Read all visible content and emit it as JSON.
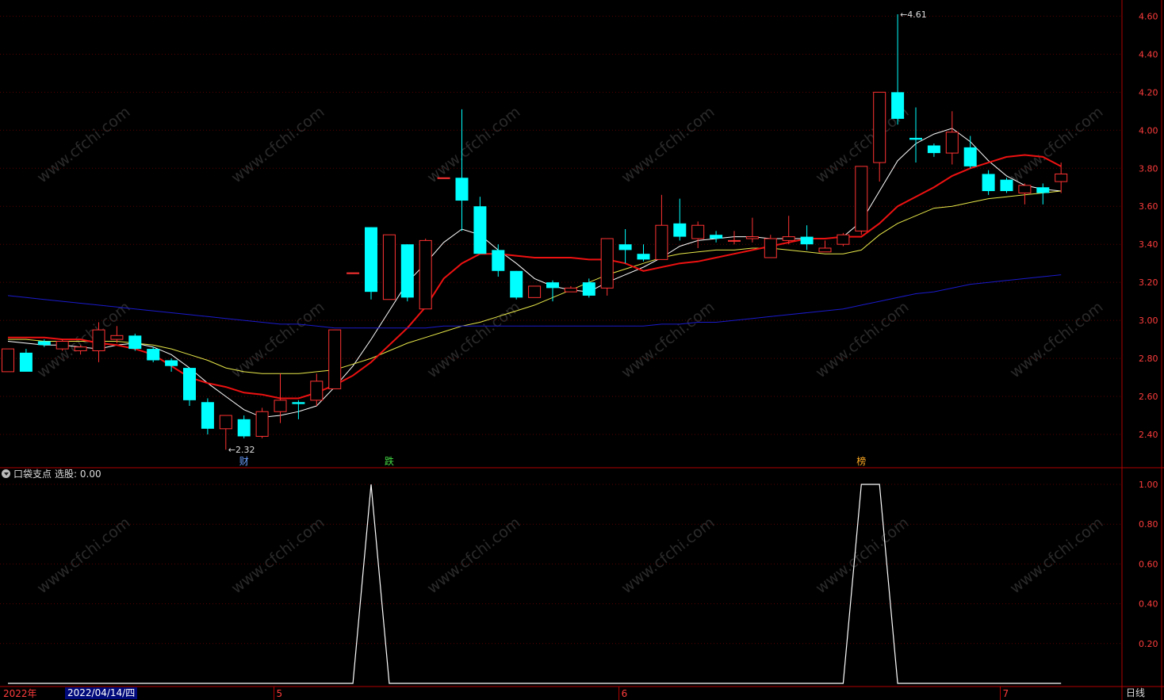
{
  "chart_data": [
    {
      "type": "candlestick",
      "ylim": [
        2.25,
        4.66
      ],
      "yticks": [
        "2.40",
        "2.60",
        "2.80",
        "3.00",
        "3.20",
        "3.40",
        "3.60",
        "3.80",
        "4.00",
        "4.20",
        "4.40",
        "4.60"
      ],
      "candles": [
        [
          2.73,
          2.85,
          2.75,
          2.84
        ],
        [
          2.83,
          2.73,
          2.74,
          2.85
        ],
        [
          2.89,
          2.87,
          2.86,
          2.9
        ],
        [
          2.85,
          2.89,
          2.84,
          2.9
        ],
        [
          2.84,
          2.86,
          2.82,
          2.87
        ],
        [
          2.84,
          2.95,
          2.78,
          2.99
        ],
        [
          2.9,
          2.92,
          2.88,
          2.97
        ],
        [
          2.92,
          2.85,
          2.84,
          2.93
        ],
        [
          2.85,
          2.79,
          2.78,
          2.86
        ],
        [
          2.79,
          2.76,
          2.73,
          2.8
        ],
        [
          2.75,
          2.58,
          2.55,
          2.75
        ],
        [
          2.57,
          2.43,
          2.4,
          2.59
        ],
        [
          2.43,
          2.5,
          2.32,
          2.5
        ],
        [
          2.48,
          2.39,
          2.38,
          2.5
        ],
        [
          2.39,
          2.52,
          2.38,
          2.54
        ],
        [
          2.52,
          2.58,
          2.46,
          2.72
        ],
        [
          2.57,
          2.56,
          2.48,
          2.58
        ],
        [
          2.58,
          2.68,
          2.55,
          2.72
        ],
        [
          2.64,
          2.95,
          2.64,
          2.95
        ],
        [
          3.25,
          3.25,
          3.25,
          3.25
        ],
        [
          3.49,
          3.15,
          3.11,
          3.49
        ],
        [
          3.11,
          3.45,
          3.11,
          3.45
        ],
        [
          3.4,
          3.12,
          3.1,
          3.4
        ],
        [
          3.06,
          3.42,
          3.06,
          3.43
        ],
        [
          3.75,
          3.75,
          3.75,
          3.75
        ],
        [
          3.75,
          3.63,
          3.47,
          4.11
        ],
        [
          3.6,
          3.35,
          3.35,
          3.65
        ],
        [
          3.37,
          3.26,
          3.23,
          3.4
        ],
        [
          3.26,
          3.12,
          3.11,
          3.26
        ],
        [
          3.12,
          3.18,
          3.12,
          3.18
        ],
        [
          3.2,
          3.17,
          3.1,
          3.21
        ],
        [
          3.15,
          3.17,
          3.15,
          3.18
        ],
        [
          3.2,
          3.13,
          3.12,
          3.22
        ],
        [
          3.17,
          3.43,
          3.13,
          3.43
        ],
        [
          3.4,
          3.37,
          3.3,
          3.48
        ],
        [
          3.35,
          3.32,
          3.31,
          3.4
        ],
        [
          3.32,
          3.5,
          3.32,
          3.66
        ],
        [
          3.51,
          3.44,
          3.42,
          3.64
        ],
        [
          3.43,
          3.5,
          3.38,
          3.52
        ],
        [
          3.45,
          3.43,
          3.41,
          3.47
        ],
        [
          3.42,
          3.42,
          3.4,
          3.47
        ],
        [
          3.43,
          3.44,
          3.41,
          3.54
        ],
        [
          3.33,
          3.43,
          3.33,
          3.45
        ],
        [
          3.42,
          3.44,
          3.4,
          3.55
        ],
        [
          3.44,
          3.4,
          3.37,
          3.5
        ],
        [
          3.36,
          3.38,
          3.36,
          3.42
        ],
        [
          3.4,
          3.45,
          3.39,
          3.46
        ],
        [
          3.47,
          3.81,
          3.45,
          3.81
        ],
        [
          3.83,
          4.2,
          3.73,
          4.2
        ],
        [
          4.2,
          4.06,
          4.03,
          4.61
        ],
        [
          3.96,
          3.95,
          3.83,
          4.12
        ],
        [
          3.92,
          3.88,
          3.86,
          3.93
        ],
        [
          3.88,
          3.99,
          3.82,
          4.1
        ],
        [
          3.91,
          3.81,
          3.8,
          3.97
        ],
        [
          3.77,
          3.68,
          3.66,
          3.79
        ],
        [
          3.74,
          3.68,
          3.67,
          3.75
        ],
        [
          3.67,
          3.71,
          3.61,
          3.72
        ],
        [
          3.7,
          3.67,
          3.61,
          3.72
        ],
        [
          3.73,
          3.77,
          3.67,
          3.83
        ]
      ],
      "ma_series": [
        {
          "color": "#ffffff",
          "values": [
            2.89,
            2.88,
            2.87,
            2.87,
            2.86,
            2.85,
            2.87,
            2.88,
            2.86,
            2.82,
            2.75,
            2.67,
            2.6,
            2.53,
            2.49,
            2.5,
            2.52,
            2.55,
            2.65,
            2.76,
            2.9,
            3.05,
            3.2,
            3.3,
            3.41,
            3.48,
            3.45,
            3.37,
            3.3,
            3.22,
            3.18,
            3.16,
            3.15,
            3.2,
            3.24,
            3.28,
            3.33,
            3.39,
            3.42,
            3.43,
            3.44,
            3.44,
            3.43,
            3.43,
            3.43,
            3.43,
            3.44,
            3.52,
            3.68,
            3.84,
            3.93,
            3.98,
            4.01,
            3.94,
            3.84,
            3.76,
            3.71,
            3.69,
            3.68
          ]
        },
        {
          "color": "#e8e84a",
          "values": [
            2.9,
            2.9,
            2.89,
            2.89,
            2.89,
            2.89,
            2.89,
            2.88,
            2.87,
            2.85,
            2.82,
            2.79,
            2.75,
            2.73,
            2.72,
            2.72,
            2.72,
            2.73,
            2.74,
            2.77,
            2.8,
            2.84,
            2.88,
            2.91,
            2.94,
            2.97,
            2.99,
            3.02,
            3.05,
            3.08,
            3.12,
            3.16,
            3.2,
            3.24,
            3.27,
            3.3,
            3.33,
            3.35,
            3.36,
            3.37,
            3.37,
            3.38,
            3.38,
            3.37,
            3.36,
            3.35,
            3.35,
            3.37,
            3.45,
            3.51,
            3.55,
            3.59,
            3.6,
            3.62,
            3.64,
            3.65,
            3.66,
            3.67,
            3.68
          ]
        },
        {
          "color": "#ee1111",
          "values": [
            2.91,
            2.91,
            2.91,
            2.9,
            2.9,
            2.88,
            2.87,
            2.85,
            2.82,
            2.76,
            2.7,
            2.67,
            2.65,
            2.62,
            2.61,
            2.59,
            2.59,
            2.62,
            2.66,
            2.71,
            2.78,
            2.87,
            2.96,
            3.07,
            3.22,
            3.3,
            3.35,
            3.35,
            3.34,
            3.33,
            3.33,
            3.33,
            3.32,
            3.32,
            3.3,
            3.26,
            3.28,
            3.3,
            3.31,
            3.33,
            3.35,
            3.37,
            3.39,
            3.41,
            3.43,
            3.43,
            3.44,
            3.44,
            3.51,
            3.6,
            3.65,
            3.7,
            3.76,
            3.8,
            3.83,
            3.86,
            3.87,
            3.86,
            3.81
          ]
        },
        {
          "color": "#1a1acc",
          "values": [
            3.13,
            3.12,
            3.11,
            3.1,
            3.09,
            3.08,
            3.07,
            3.06,
            3.05,
            3.04,
            3.03,
            3.02,
            3.01,
            3.0,
            2.99,
            2.98,
            2.98,
            2.97,
            2.96,
            2.96,
            2.96,
            2.96,
            2.96,
            2.96,
            2.97,
            2.97,
            2.97,
            2.97,
            2.97,
            2.97,
            2.97,
            2.97,
            2.97,
            2.97,
            2.97,
            2.97,
            2.98,
            2.98,
            2.99,
            2.99,
            3.0,
            3.01,
            3.02,
            3.03,
            3.04,
            3.05,
            3.06,
            3.08,
            3.1,
            3.12,
            3.14,
            3.15,
            3.17,
            3.19,
            3.2,
            3.21,
            3.22,
            3.23,
            3.24
          ]
        }
      ],
      "annotations": [
        {
          "text": "4.61",
          "index": 49,
          "value": 4.61
        },
        {
          "text": "2.32",
          "index": 12,
          "value": 2.32
        }
      ],
      "markers": [
        {
          "text": "财",
          "index": 13,
          "color": "#6aa0ff"
        },
        {
          "text": "跌",
          "index": 21,
          "color": "#44dd44"
        },
        {
          "text": "榜",
          "index": 47,
          "color": "#ffaa22"
        }
      ]
    },
    {
      "type": "line",
      "name": "口袋支点 选股",
      "ylim": [
        0,
        1.1
      ],
      "yticks": [
        "0.20",
        "0.40",
        "0.60",
        "0.80",
        "1.00"
      ],
      "values": [
        0,
        0,
        0,
        0,
        0,
        0,
        0,
        0,
        0,
        0,
        0,
        0,
        0,
        0,
        0,
        0,
        0,
        0,
        0,
        0,
        1,
        0,
        0,
        0,
        0,
        0,
        0,
        0,
        0,
        0,
        0,
        0,
        0,
        0,
        0,
        0,
        0,
        0,
        0,
        0,
        0,
        0,
        0,
        0,
        0,
        0,
        0,
        1,
        1,
        0,
        0,
        0,
        0,
        0,
        0,
        0,
        0,
        0,
        0
      ]
    }
  ],
  "indicator": {
    "name": "口袋支点",
    "value_label": "选股: 0.00"
  },
  "xaxis": {
    "year": "2022年",
    "months": [
      {
        "label": "5",
        "index": 15
      },
      {
        "label": "6",
        "index": 34
      },
      {
        "label": "7",
        "index": 55
      }
    ]
  },
  "cursor_date": "2022/04/14/四",
  "period": "日线",
  "watermark": "www.cfchi.com",
  "colors": {
    "up": "#ff3232",
    "down": "#00ffff",
    "background": "#000000",
    "frame": "#b00000",
    "axis_text": "#ff3c3c"
  }
}
